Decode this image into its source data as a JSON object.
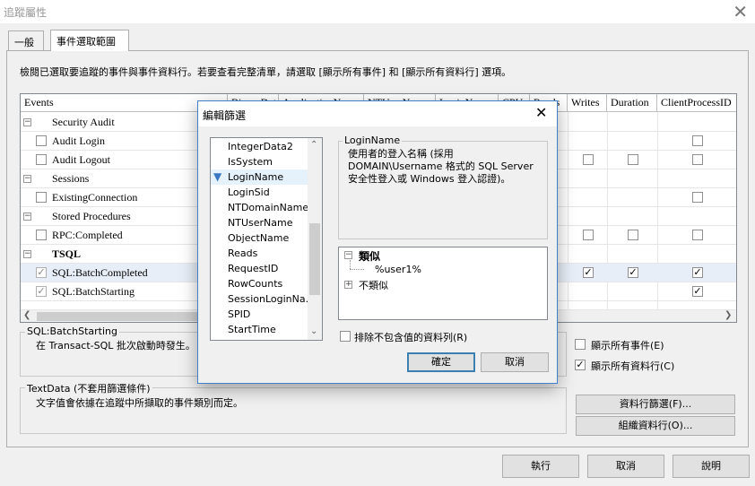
{
  "window": {
    "title": "追蹤屬性"
  },
  "tabs": [
    {
      "label": "一般"
    },
    {
      "label": "事件選取範圍"
    }
  ],
  "description": "檢閱已選取要追蹤的事件與事件資料行。若要查看完整清單，請選取 [顯示所有事件] 和 [顯示所有資料行] 選項。",
  "grid": {
    "columns": [
      "Events",
      "BinaryData",
      "ApplicationName",
      "NTUserName",
      "LoginName",
      "CPU",
      "Reads",
      "Writes",
      "Duration",
      "ClientProcessID"
    ],
    "rows": [
      {
        "type": "category",
        "label": "Security Audit"
      },
      {
        "type": "event",
        "label": "Audit Login"
      },
      {
        "type": "event",
        "label": "Audit Logout"
      },
      {
        "type": "category",
        "label": "Sessions"
      },
      {
        "type": "event",
        "label": "ExistingConnection"
      },
      {
        "type": "category",
        "label": "Stored Procedures"
      },
      {
        "type": "event",
        "label": "RPC:Completed"
      },
      {
        "type": "category",
        "label": "TSQL"
      },
      {
        "type": "event",
        "label": "SQL:BatchCompleted"
      },
      {
        "type": "event",
        "label": "SQL:BatchStarting"
      }
    ],
    "checkmark": "✓"
  },
  "event_box": {
    "legend": "SQL:BatchStarting",
    "text": "在 Transact-SQL 批次啟動時發生。"
  },
  "data_box": {
    "legend": "TextData (不套用篩選條件)",
    "text": "文字值會依據在追蹤中所擷取的事件類別而定。"
  },
  "options": {
    "show_all_events": "顯示所有事件(E)",
    "show_all_columns": "顯示所有資料行(C)"
  },
  "side_buttons": {
    "column_filters": "資料行篩選(F)...",
    "organize_columns": "組織資料行(O)..."
  },
  "footer": {
    "run": "執行",
    "cancel": "取消",
    "help": "說明"
  },
  "dialog": {
    "title": "編輯篩選",
    "columns": [
      "IntegerData2",
      "IsSystem",
      "LoginName",
      "LoginSid",
      "NTDomainName",
      "NTUserName",
      "ObjectName",
      "Reads",
      "RequestID",
      "RowCounts",
      "SessionLoginNa...",
      "SPID",
      "StartTime"
    ],
    "selected_column": "LoginName",
    "info": {
      "legend": "LoginName",
      "text": "使用者的登入名稱 (採用 DOMAIN\\Username 格式的 SQL Server 安全性登入或 Windows 登入認證)。"
    },
    "tree": {
      "like": "類似",
      "value": "%user1%",
      "not_like": "不類似"
    },
    "exclude_label": "排除不包含值的資料列(R)",
    "ok": "確定",
    "cancel": "取消"
  }
}
